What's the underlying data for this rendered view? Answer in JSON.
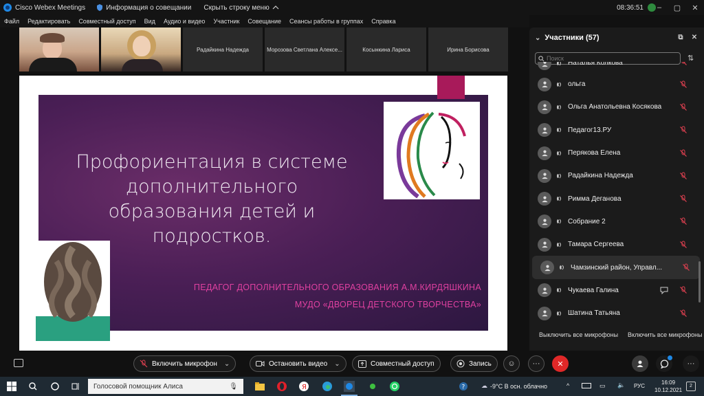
{
  "titlebar": {
    "app_title": "Cisco Webex Meetings",
    "meeting_info": "Информация о совещании",
    "hide_menu": "Скрыть строку меню",
    "time": "08:36:51"
  },
  "menu": [
    "Файл",
    "Редактировать",
    "Совместный доступ",
    "Вид",
    "Аудио и видео",
    "Участник",
    "Совещание",
    "Сеансы работы в группах",
    "Справка"
  ],
  "video_tiles": [
    "Радайкина Надежда",
    "Морозова Светлана Алексе...",
    "Косынкина Лариса",
    "Ирина Борисова"
  ],
  "slide": {
    "title": "Профориентация в системе дополнительного образования детей и подростков.",
    "subtitle_line1": "ПЕДАГОГ ДОПОЛНИТЕЛЬНОГО ОБРАЗОВАНИЯ А.М.КИРДЯШКИНА",
    "subtitle_line2": "МУДО «ДВОРЕЦ ДЕТСКОГО ТВОРЧЕСТВА»"
  },
  "participants_panel": {
    "title": "Участники (57)",
    "search_placeholder": "Поиск",
    "participants": [
      {
        "name": "Наталья Колкова",
        "chat": false,
        "highlighted": false
      },
      {
        "name": "ольга",
        "chat": false,
        "highlighted": false
      },
      {
        "name": "Ольга Анатольевна Косякова",
        "chat": false,
        "highlighted": false
      },
      {
        "name": "Педагог13.РУ",
        "chat": false,
        "highlighted": false
      },
      {
        "name": "Перякова Елена",
        "chat": false,
        "highlighted": false
      },
      {
        "name": "Радайкина Надежда",
        "chat": false,
        "highlighted": false
      },
      {
        "name": "Римма Деганова",
        "chat": false,
        "highlighted": false
      },
      {
        "name": "Собрание 2",
        "chat": false,
        "highlighted": false
      },
      {
        "name": "Тамара Сергеева",
        "chat": false,
        "highlighted": false
      },
      {
        "name": "Чамзинский район, Управл...",
        "chat": false,
        "highlighted": true
      },
      {
        "name": "Чукаева Галина",
        "chat": true,
        "highlighted": false
      },
      {
        "name": "Шатина Татьяна",
        "chat": false,
        "highlighted": false
      }
    ],
    "footer_btn1": "Выключить все микрофоны",
    "footer_btn2": "Включить все микрофоны"
  },
  "controls": {
    "unmute": "Включить микрофон",
    "stop_video": "Остановить видео",
    "share": "Совместный доступ",
    "record": "Запись"
  },
  "taskbar": {
    "search_text": "Голосовой помощник Алиса",
    "weather": "-9°C  В осн. облачно",
    "lang": "РУС",
    "clock_time": "16:09",
    "clock_date": "10.12.2021",
    "notif_count": "2"
  },
  "colors": {
    "end_button": "#e02828",
    "mic_off": "#e04050",
    "slide_subtitle": "#e040a0",
    "slide_accent": "#a81a5a"
  }
}
